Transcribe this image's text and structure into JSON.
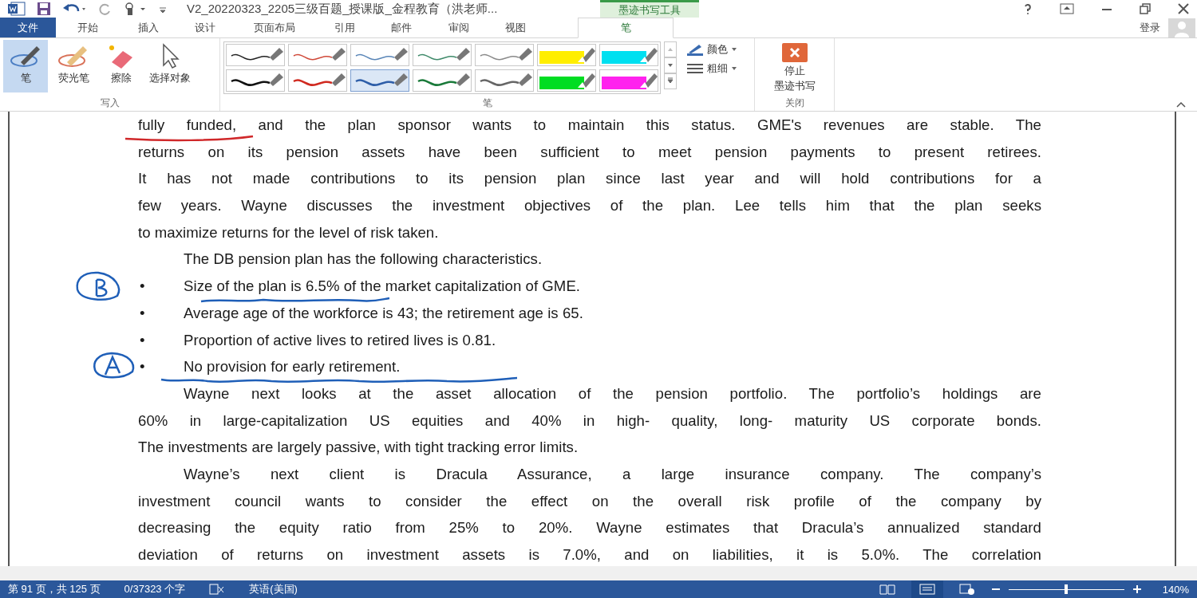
{
  "window": {
    "title": "V2_20220323_2205三级百题_授课版_金程教育（洪老师..."
  },
  "contextual_tab_group": "墨迹书写工具",
  "tabs": [
    {
      "label": "文件",
      "kind": "file",
      "selected": false
    },
    {
      "label": "开始",
      "kind": "tab",
      "selected": false
    },
    {
      "label": "插入",
      "kind": "tab",
      "selected": false
    },
    {
      "label": "设计",
      "kind": "tab",
      "selected": false
    },
    {
      "label": "页面布局",
      "kind": "tab",
      "selected": false
    },
    {
      "label": "引用",
      "kind": "tab",
      "selected": false
    },
    {
      "label": "邮件",
      "kind": "tab",
      "selected": false
    },
    {
      "label": "审阅",
      "kind": "tab",
      "selected": false
    },
    {
      "label": "视图",
      "kind": "tab",
      "selected": false
    },
    {
      "label": "笔",
      "kind": "contextual",
      "selected": true
    }
  ],
  "account": {
    "sign_in": "登录"
  },
  "ribbon": {
    "write_group": {
      "label": "写入",
      "tools": [
        {
          "label": "笔",
          "kind": "pen",
          "selected": true
        },
        {
          "label": "荧光笔",
          "kind": "highlighter",
          "selected": false
        },
        {
          "label": "擦除",
          "kind": "eraser",
          "selected": false
        },
        {
          "label": "选择对象",
          "kind": "select",
          "selected": false
        }
      ]
    },
    "pens_group": {
      "label": "笔",
      "pens": [
        {
          "kind": "thin",
          "color": "#222222",
          "selected": false
        },
        {
          "kind": "thin",
          "color": "#d04a3a",
          "selected": false
        },
        {
          "kind": "thin",
          "color": "#5a86b8",
          "selected": false
        },
        {
          "kind": "thin",
          "color": "#3f8a6a",
          "selected": false
        },
        {
          "kind": "thin",
          "color": "#8a8a8a",
          "selected": false
        },
        {
          "kind": "highlighter",
          "color": "#ffee00",
          "selected": false
        },
        {
          "kind": "highlighter",
          "color": "#00e0f0",
          "selected": false
        },
        {
          "kind": "thick",
          "color": "#111111",
          "selected": false
        },
        {
          "kind": "thick",
          "color": "#d02a20",
          "selected": false
        },
        {
          "kind": "thick",
          "color": "#2e5ea8",
          "selected": true
        },
        {
          "kind": "thick",
          "color": "#1a7a3a",
          "selected": false
        },
        {
          "kind": "thick",
          "color": "#666666",
          "selected": false
        },
        {
          "kind": "highlighter",
          "color": "#00dd22",
          "selected": false
        },
        {
          "kind": "highlighter",
          "color": "#ff22ee",
          "selected": false
        }
      ],
      "color_button": "颜色",
      "thickness_button": "粗细"
    },
    "close_group": {
      "label": "关闭",
      "button_lines": [
        "停止",
        "墨迹书写"
      ]
    }
  },
  "document": {
    "lines": [
      {
        "text": "fully funded, and the plan sponsor wants to maintain this status. GME's revenues are stable. The",
        "kind": "justify"
      },
      {
        "text": "returns on its pension assets have been sufficient to meet pension payments to present retirees.",
        "kind": "justify"
      },
      {
        "text": "It has not made contributions to its pension plan since last year and will hold contributions for a",
        "kind": "justify"
      },
      {
        "text": "few years. Wayne discusses the investment objectives of the plan. Lee tells him that the plan seeks",
        "kind": "justify"
      },
      {
        "text": "to maximize returns for the level of risk taken.",
        "kind": "last"
      },
      {
        "text": "The DB pension plan has the following characteristics.",
        "kind": "indent"
      },
      {
        "text": "Size of the plan is 6.5% of the market capitalization of GME.",
        "kind": "bullet",
        "bullet": "•"
      },
      {
        "text": "Average age of the workforce is 43; the retirement age is 65.",
        "kind": "bullet",
        "bullet": "•"
      },
      {
        "text": "Proportion of active lives to retired lives is 0.81.",
        "kind": "bullet",
        "bullet": "•"
      },
      {
        "text": "No provision for early retirement.",
        "kind": "bullet",
        "bullet": "•"
      },
      {
        "text": "Wayne next looks at the asset allocation of the pension portfolio. The portfolio’s holdings are",
        "kind": "indent-justify"
      },
      {
        "text": "60% in large-capitalization US equities and 40% in high- quality, long- maturity US corporate bonds.",
        "kind": "justify"
      },
      {
        "text": "The investments are largely passive, with tight tracking error limits.",
        "kind": "last"
      },
      {
        "text": "Wayne’s next client is Dracula Assurance, a large insurance company. The company’s",
        "kind": "indent-justify"
      },
      {
        "text": "investment council wants to consider the effect on the overall risk profile of the company by",
        "kind": "justify"
      },
      {
        "text": "decreasing the equity ratio from 25% to 20%. Wayne estimates that Dracula’s annualized standard",
        "kind": "justify"
      },
      {
        "text": "deviation of returns on investment assets is 7.0%, and on liabilities, it is 5.0%. The correlation",
        "kind": "justify"
      }
    ]
  },
  "status_bar": {
    "page": "第 91 页，共 125 页",
    "words": "0/37323 个字",
    "language": "英语(美国)",
    "views": [
      {
        "kind": "read",
        "selected": false
      },
      {
        "kind": "print",
        "selected": true
      },
      {
        "kind": "web",
        "selected": false
      }
    ],
    "zoom": {
      "level": 0.5,
      "reading": "140%"
    }
  }
}
